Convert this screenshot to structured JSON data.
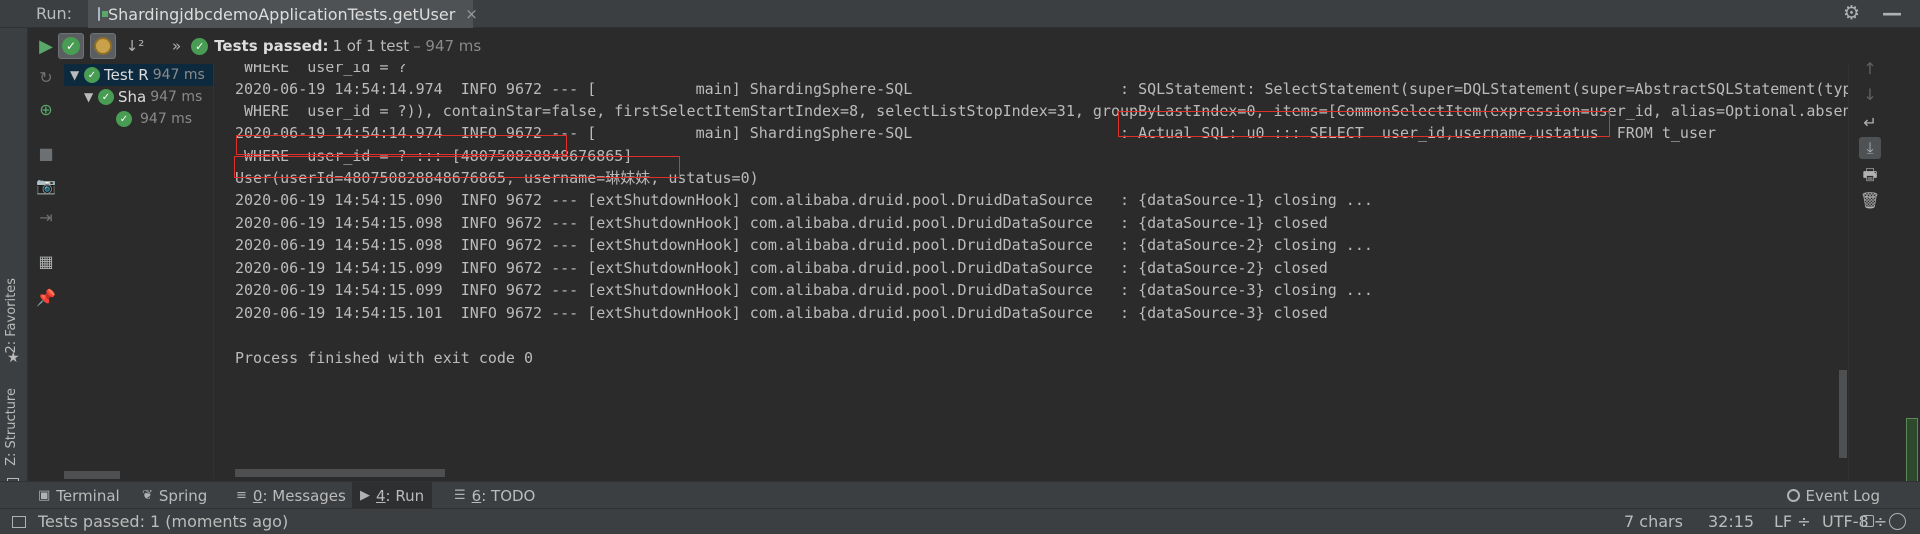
{
  "titlebar": {
    "run_label": "Run:",
    "tab_title": "ShardingjdbcdemoApplicationTests.getUser",
    "tab_close": "×",
    "settings_glyph": "⚙",
    "minimize_glyph": "—"
  },
  "toolbar": {
    "sort_glyph": "↓²",
    "more_glyph": "»",
    "status_strong": "Tests passed:",
    "status_rest": "1 of 1 test",
    "status_time": "– 947 ms"
  },
  "left_strip": {
    "favorites_label": "2: Favorites",
    "structure_label": "Z: Structure",
    "star_glyph": "★"
  },
  "side_tools": {
    "run_glyph": "▶",
    "icons": [
      "↻",
      "⊕",
      "⫸",
      "■",
      "📷",
      "⇥",
      "▦",
      "📌"
    ]
  },
  "tree": {
    "rows": [
      {
        "arrow": "▼",
        "label": "Test R",
        "time": "947 ms"
      },
      {
        "arrow": "▼",
        "label": "Sha",
        "time": "947 ms"
      },
      {
        "arrow": "",
        "label": "",
        "time": "947 ms"
      }
    ]
  },
  "console": {
    "lines": [
      " WHERE  user_id = ?",
      "2020-06-19 14:54:14.974  INFO 9672 --- [           main] ShardingSphere-SQL                       : SQLStatement: SelectStatement(super=DQLStatement(super=AbstractSQLStatement(type",
      " WHERE  user_id = ?)), containStar=false, firstSelectItemStartIndex=8, selectListStopIndex=31, groupByLastIndex=0, items=[CommonSelectItem(expression=user_id, alias=Optional.absent",
      "2020-06-19 14:54:14.974  INFO 9672 --- [           main] ShardingSphere-SQL                       : Actual SQL: u0 ::: SELECT  user_id,username,ustatus  FROM t_user",
      " WHERE  user_id = ? ::: [480750828848676865]",
      "User(userId=480750828848676865, username=琳妹妹, ustatus=0)",
      "2020-06-19 14:54:15.090  INFO 9672 --- [extShutdownHook] com.alibaba.druid.pool.DruidDataSource   : {dataSource-1} closing ...",
      "2020-06-19 14:54:15.098  INFO 9672 --- [extShutdownHook] com.alibaba.druid.pool.DruidDataSource   : {dataSource-1} closed",
      "2020-06-19 14:54:15.098  INFO 9672 --- [extShutdownHook] com.alibaba.druid.pool.DruidDataSource   : {dataSource-2} closing ...",
      "2020-06-19 14:54:15.099  INFO 9672 --- [extShutdownHook] com.alibaba.druid.pool.DruidDataSource   : {dataSource-2} closed",
      "2020-06-19 14:54:15.099  INFO 9672 --- [extShutdownHook] com.alibaba.druid.pool.DruidDataSource   : {dataSource-3} closing ...",
      "2020-06-19 14:54:15.101  INFO 9672 --- [extShutdownHook] com.alibaba.druid.pool.DruidDataSource   : {dataSource-3} closed",
      "",
      "Process finished with exit code 0"
    ]
  },
  "right_tools": {
    "icons": [
      "↑",
      "↓",
      "↵",
      "⤓",
      "🖶",
      "🗑"
    ]
  },
  "tool_tabs": {
    "terminal": {
      "icon": "▣",
      "label": "Terminal"
    },
    "spring": {
      "icon": "❦",
      "label": "Spring"
    },
    "messages": {
      "icon": "≡",
      "key": "0",
      "rest": ": Messages"
    },
    "run": {
      "icon": "▶",
      "key": "4",
      "rest": ": Run"
    },
    "todo": {
      "icon": "☰",
      "key": "6",
      "rest": ": TODO"
    },
    "event_log": "Event Log"
  },
  "statusbar": {
    "message": "Tests passed: 1 (moments ago)",
    "chars": "7 chars",
    "position": "32:15",
    "line_sep": "LF ÷",
    "encoding": "UTF-8 ÷"
  },
  "colors": {
    "highlight_box": "#e0302a",
    "success_green": "#499c54",
    "background": "#2b2b2b"
  }
}
